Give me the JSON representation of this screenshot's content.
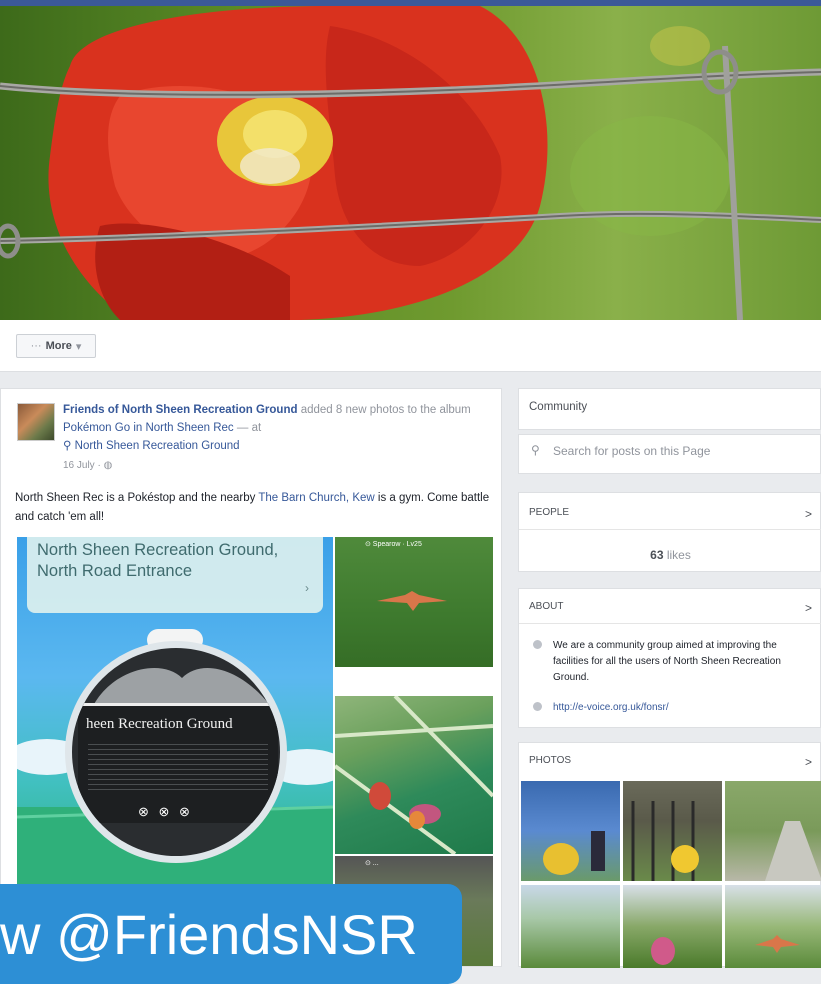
{
  "actions": {
    "more_label": "More",
    "more_dots": "···",
    "more_caret": "▾"
  },
  "post": {
    "author": "Friends of North Sheen Recreation Ground",
    "action_text": " added 8 new photos to the album ",
    "album": "Pokémon Go in North Sheen Rec",
    "at_text": " — at",
    "place": "North Sheen Recreation Ground",
    "time": "16 July · ",
    "text_before": "North Sheen Rec is a Pokéstop and the nearby ",
    "text_link": "The Barn Church, Kew",
    "text_after": " is a gym. Come battle and catch 'em all!",
    "main_photo": {
      "location_title": "North Sheen Recreation Ground, North Road Entrance",
      "sign_text": "heen Recreation Ground",
      "sign_icons": "⊗ ⊗ ⊗"
    },
    "tile1_label": "⊙ Spearow · Lv25",
    "tile3_label": "⊙ ..."
  },
  "sidebar": {
    "category": "Community",
    "search_placeholder": "Search for posts on this Page",
    "people_title": "PEOPLE",
    "likes_count": "63",
    "likes_word": " likes",
    "about_title": "ABOUT",
    "about_desc": "We are a community group aimed at improving the facilities for all the users of North Sheen Recreation Ground.",
    "about_link": "http://e-voice.org.uk/fonsr/",
    "photos_title": "PHOTOS",
    "chevron": ">"
  },
  "banner": {
    "text": "w @FriendsNSR"
  },
  "colors": {
    "brand_blue": "#3b5998",
    "link": "#365899",
    "banner": "#2d8fd5"
  }
}
